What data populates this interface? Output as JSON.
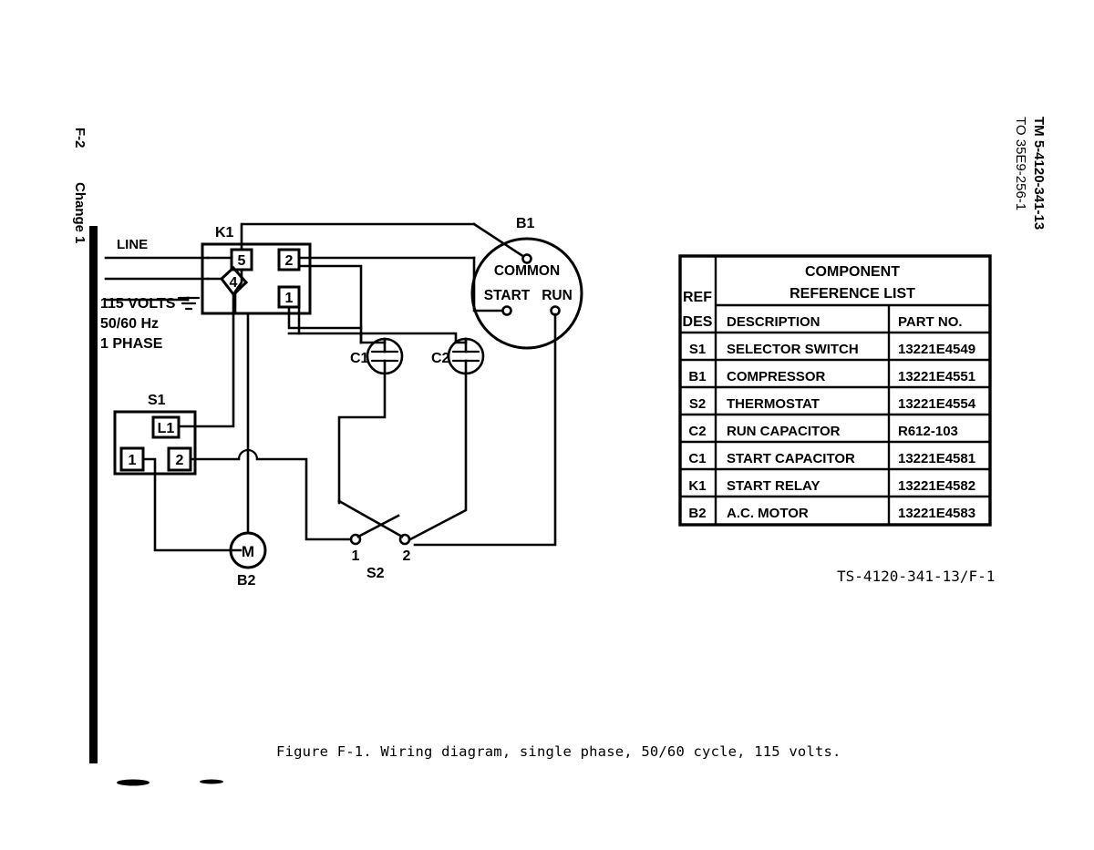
{
  "page": {
    "folio": "F-2",
    "change_note": "Change 1",
    "tm_number": "TM 5-4120-341-13",
    "to_number": "TO 35E9-256-1",
    "drawing_number": "TS-4120-341-13/F-1",
    "caption": "Figure F-1.  Wiring diagram, single phase, 50/60 cycle, 115 volts."
  },
  "supply": {
    "line_label": "LINE",
    "voltage": "115 VOLTS",
    "frequency": "50/60 Hz",
    "phase": "1 PHASE"
  },
  "components": {
    "relay": {
      "ref": "K1",
      "terminals": [
        "5",
        "2",
        "1",
        "4"
      ]
    },
    "compressor": {
      "ref": "B1",
      "terminals": [
        "COMMON",
        "START",
        "RUN"
      ]
    },
    "start_capacitor": {
      "ref": "C1"
    },
    "run_capacitor": {
      "ref": "C2"
    },
    "selector_switch": {
      "ref": "S1",
      "terminals": [
        "L1",
        "1",
        "2"
      ]
    },
    "thermostat": {
      "ref": "S2",
      "terminals": [
        "1",
        "2"
      ]
    },
    "motor": {
      "ref": "B2",
      "symbol": "M"
    }
  },
  "reference_table": {
    "title_line1": "COMPONENT",
    "title_line2": "REFERENCE LIST",
    "ref_des_line1": "REF",
    "ref_des_line2": "DES",
    "col_description": "DESCRIPTION",
    "col_part_no": "PART NO.",
    "rows": [
      {
        "ref": "S1",
        "description": "SELECTOR SWITCH",
        "part": "13221E4549"
      },
      {
        "ref": "B1",
        "description": "COMPRESSOR",
        "part": "13221E4551"
      },
      {
        "ref": "S2",
        "description": "THERMOSTAT",
        "part": "13221E4554"
      },
      {
        "ref": "C2",
        "description": "RUN CAPACITOR",
        "part": "R612-103"
      },
      {
        "ref": "C1",
        "description": "START CAPACITOR",
        "part": "13221E4581"
      },
      {
        "ref": "K1",
        "description": "START RELAY",
        "part": "13221E4582"
      },
      {
        "ref": "B2",
        "description": "A.C. MOTOR",
        "part": "13221E4583"
      }
    ]
  },
  "colors": {
    "ink": "#000000",
    "paper": "#ffffff"
  }
}
